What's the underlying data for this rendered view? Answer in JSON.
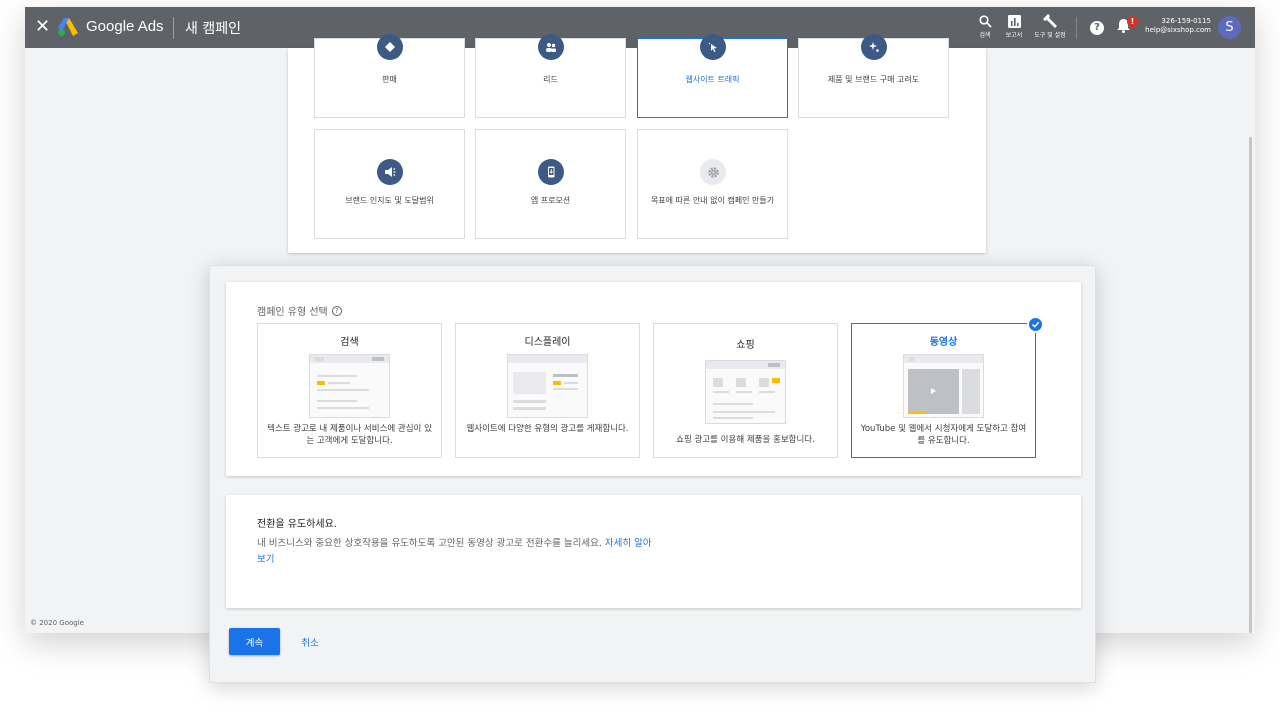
{
  "topbar": {
    "close_label": "✕",
    "brand": "Google Ads",
    "page_title": "새 캠페인",
    "tools": [
      {
        "icon": "search-icon",
        "label": "검색"
      },
      {
        "icon": "reports-icon",
        "label": "보고서"
      },
      {
        "icon": "wrench-icon",
        "label": "도구 및 설정"
      }
    ],
    "help_label": "?",
    "notification_badge": "!",
    "account_id": "326-159-0115",
    "account_email": "help@sixshop.com",
    "avatar_letter": "S"
  },
  "footer": {
    "copyright": "© 2020 Google"
  },
  "goals": [
    {
      "label": "판매",
      "icon": "tag-icon",
      "selected": false
    },
    {
      "label": "리드",
      "icon": "people-icon",
      "selected": false
    },
    {
      "label": "웹사이트 트래픽",
      "icon": "cursor-icon",
      "selected": true
    },
    {
      "label": "제품 및 브랜드 구매 고려도",
      "icon": "sparkle-icon",
      "selected": false
    },
    {
      "label": "브랜드 인지도 및 도달범위",
      "icon": "megaphone-icon",
      "selected": false
    },
    {
      "label": "앱 프로모션",
      "icon": "phone-icon",
      "selected": false
    },
    {
      "label": "목표에 따른 안내 없이 캠페인 만들기",
      "icon": "gear-icon",
      "selected": false
    }
  ],
  "campaign_type": {
    "title": "캠페인 유형 선택",
    "types": [
      {
        "name": "검색",
        "description": "텍스트 광고로 내 제품이나 서비스에 관심이 있는 고객에게 도달합니다.",
        "selected": false
      },
      {
        "name": "디스플레이",
        "description": "웹사이트에 다양한 유형의 광고를 게재합니다.",
        "selected": false
      },
      {
        "name": "쇼핑",
        "description": "쇼핑 광고를 이용해 제품을 홍보합니다.",
        "selected": false
      },
      {
        "name": "동영상",
        "description": "YouTube 및 웹에서 시청자에게 도달하고 참여를 유도합니다.",
        "selected": true
      }
    ]
  },
  "info": {
    "heading": "전환을 유도하세요.",
    "body": "내 비즈니스와 중요한 상호작용을 유도하도록 고안된 동영상 광고로 전환수를 늘리세요. ",
    "link": "자세히 알아보기"
  },
  "actions": {
    "continue_label": "계속",
    "cancel_label": "취소"
  },
  "colors": {
    "topbar": "#5f6368",
    "accent": "#1a73e8",
    "goal_icon": "#3c5a84",
    "highlight": "#fbbc04"
  }
}
